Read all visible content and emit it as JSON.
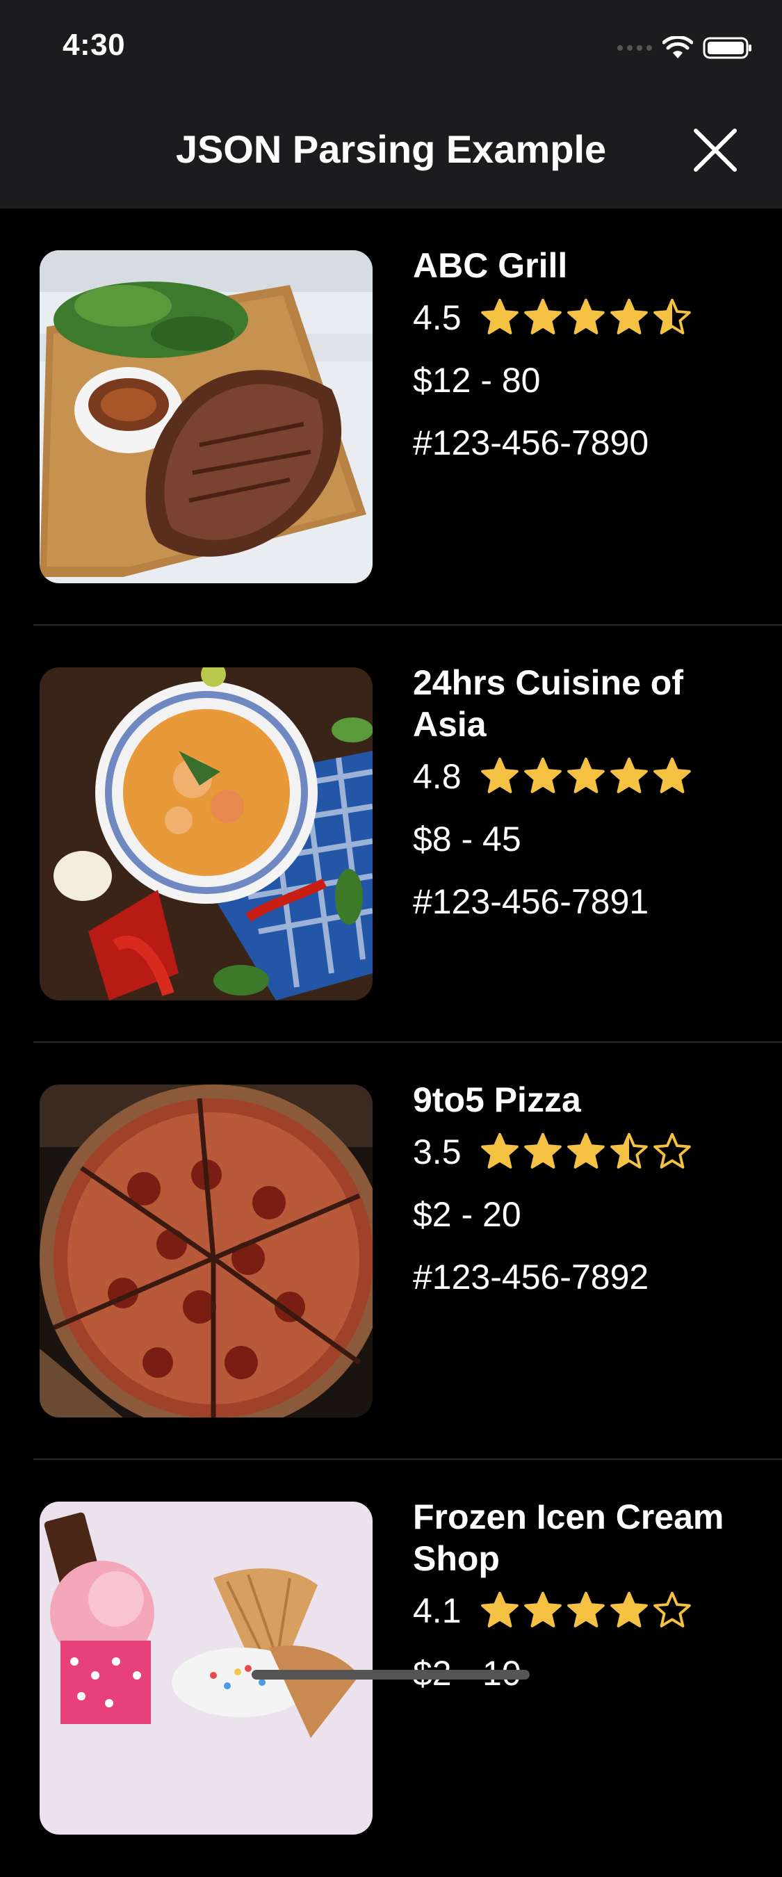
{
  "status_bar": {
    "time": "4:30"
  },
  "nav": {
    "title": "JSON Parsing Example"
  },
  "restaurants": [
    {
      "name": "ABC Grill",
      "rating": "4.5",
      "stars": [
        "full",
        "full",
        "full",
        "full",
        "half"
      ],
      "price": "$12 - 80",
      "phone": "#123-456-7890",
      "image": "steak-image"
    },
    {
      "name": "24hrs Cuisine of Asia",
      "rating": "4.8",
      "stars": [
        "full",
        "full",
        "full",
        "full",
        "full"
      ],
      "price": "$8 - 45",
      "phone": "#123-456-7891",
      "image": "soup-image"
    },
    {
      "name": "9to5 Pizza",
      "rating": "3.5",
      "stars": [
        "full",
        "full",
        "full",
        "half",
        "empty"
      ],
      "price": "$2 - 20",
      "phone": "#123-456-7892",
      "image": "pizza-image"
    },
    {
      "name": "Frozen Icen Cream Shop",
      "rating": "4.1",
      "stars": [
        "full",
        "full",
        "full",
        "full",
        "empty"
      ],
      "price": "$2 - 10",
      "phone": "",
      "image": "ice-cream-image"
    }
  ],
  "colors": {
    "background": "#000000",
    "nav_background": "#1c1c1e",
    "star": "#f5c142",
    "text": "#ffffff"
  }
}
